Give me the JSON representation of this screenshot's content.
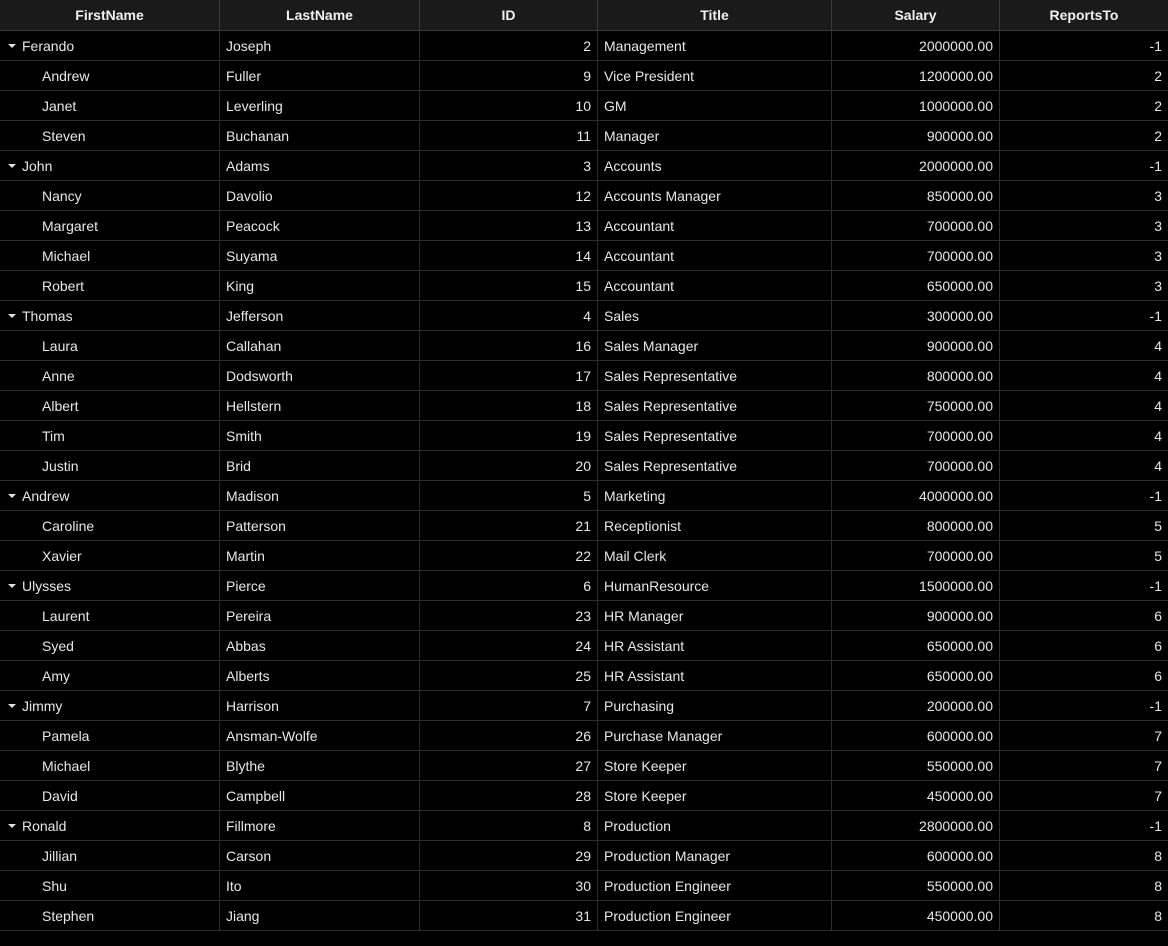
{
  "columns": {
    "first": "FirstName",
    "last": "LastName",
    "id": "ID",
    "title": "Title",
    "salary": "Salary",
    "reports": "ReportsTo"
  },
  "rows": [
    {
      "level": 0,
      "expanded": true,
      "first": "Ferando",
      "last": "Joseph",
      "id": "2",
      "title": "Management",
      "salary": "2000000.00",
      "reports": "-1"
    },
    {
      "level": 1,
      "first": "Andrew",
      "last": "Fuller",
      "id": "9",
      "title": "Vice President",
      "salary": "1200000.00",
      "reports": "2"
    },
    {
      "level": 1,
      "first": "Janet",
      "last": "Leverling",
      "id": "10",
      "title": "GM",
      "salary": "1000000.00",
      "reports": "2"
    },
    {
      "level": 1,
      "first": "Steven",
      "last": "Buchanan",
      "id": "11",
      "title": "Manager",
      "salary": "900000.00",
      "reports": "2"
    },
    {
      "level": 0,
      "expanded": true,
      "first": "John",
      "last": "Adams",
      "id": "3",
      "title": "Accounts",
      "salary": "2000000.00",
      "reports": "-1"
    },
    {
      "level": 1,
      "first": "Nancy",
      "last": "Davolio",
      "id": "12",
      "title": "Accounts Manager",
      "salary": "850000.00",
      "reports": "3"
    },
    {
      "level": 1,
      "first": "Margaret",
      "last": "Peacock",
      "id": "13",
      "title": "Accountant",
      "salary": "700000.00",
      "reports": "3"
    },
    {
      "level": 1,
      "first": "Michael",
      "last": "Suyama",
      "id": "14",
      "title": "Accountant",
      "salary": "700000.00",
      "reports": "3"
    },
    {
      "level": 1,
      "first": "Robert",
      "last": "King",
      "id": "15",
      "title": "Accountant",
      "salary": "650000.00",
      "reports": "3"
    },
    {
      "level": 0,
      "expanded": true,
      "first": "Thomas",
      "last": "Jefferson",
      "id": "4",
      "title": "Sales",
      "salary": "300000.00",
      "reports": "-1"
    },
    {
      "level": 1,
      "first": "Laura",
      "last": "Callahan",
      "id": "16",
      "title": "Sales Manager",
      "salary": "900000.00",
      "reports": "4"
    },
    {
      "level": 1,
      "first": "Anne",
      "last": "Dodsworth",
      "id": "17",
      "title": "Sales Representative",
      "salary": "800000.00",
      "reports": "4"
    },
    {
      "level": 1,
      "first": "Albert",
      "last": "Hellstern",
      "id": "18",
      "title": "Sales Representative",
      "salary": "750000.00",
      "reports": "4"
    },
    {
      "level": 1,
      "first": "Tim",
      "last": "Smith",
      "id": "19",
      "title": "Sales Representative",
      "salary": "700000.00",
      "reports": "4"
    },
    {
      "level": 1,
      "first": "Justin",
      "last": "Brid",
      "id": "20",
      "title": "Sales Representative",
      "salary": "700000.00",
      "reports": "4"
    },
    {
      "level": 0,
      "expanded": true,
      "first": "Andrew",
      "last": "Madison",
      "id": "5",
      "title": "Marketing",
      "salary": "4000000.00",
      "reports": "-1"
    },
    {
      "level": 1,
      "first": "Caroline",
      "last": "Patterson",
      "id": "21",
      "title": "Receptionist",
      "salary": "800000.00",
      "reports": "5"
    },
    {
      "level": 1,
      "first": "Xavier",
      "last": "Martin",
      "id": "22",
      "title": "Mail Clerk",
      "salary": "700000.00",
      "reports": "5"
    },
    {
      "level": 0,
      "expanded": true,
      "first": "Ulysses",
      "last": "Pierce",
      "id": "6",
      "title": "HumanResource",
      "salary": "1500000.00",
      "reports": "-1"
    },
    {
      "level": 1,
      "first": "Laurent",
      "last": "Pereira",
      "id": "23",
      "title": "HR Manager",
      "salary": "900000.00",
      "reports": "6"
    },
    {
      "level": 1,
      "first": "Syed",
      "last": "Abbas",
      "id": "24",
      "title": "HR Assistant",
      "salary": "650000.00",
      "reports": "6"
    },
    {
      "level": 1,
      "first": "Amy",
      "last": "Alberts",
      "id": "25",
      "title": "HR Assistant",
      "salary": "650000.00",
      "reports": "6"
    },
    {
      "level": 0,
      "expanded": true,
      "first": "Jimmy",
      "last": "Harrison",
      "id": "7",
      "title": "Purchasing",
      "salary": "200000.00",
      "reports": "-1"
    },
    {
      "level": 1,
      "first": "Pamela",
      "last": "Ansman-Wolfe",
      "id": "26",
      "title": "Purchase Manager",
      "salary": "600000.00",
      "reports": "7"
    },
    {
      "level": 1,
      "first": "Michael",
      "last": "Blythe",
      "id": "27",
      "title": "Store Keeper",
      "salary": "550000.00",
      "reports": "7"
    },
    {
      "level": 1,
      "first": "David",
      "last": "Campbell",
      "id": "28",
      "title": "Store Keeper",
      "salary": "450000.00",
      "reports": "7"
    },
    {
      "level": 0,
      "expanded": true,
      "first": "Ronald",
      "last": "Fillmore",
      "id": "8",
      "title": "Production",
      "salary": "2800000.00",
      "reports": "-1"
    },
    {
      "level": 1,
      "first": "Jillian",
      "last": "Carson",
      "id": "29",
      "title": "Production Manager",
      "salary": "600000.00",
      "reports": "8"
    },
    {
      "level": 1,
      "first": "Shu",
      "last": "Ito",
      "id": "30",
      "title": "Production Engineer",
      "salary": "550000.00",
      "reports": "8"
    },
    {
      "level": 1,
      "first": "Stephen",
      "last": "Jiang",
      "id": "31",
      "title": "Production Engineer",
      "salary": "450000.00",
      "reports": "8"
    }
  ]
}
